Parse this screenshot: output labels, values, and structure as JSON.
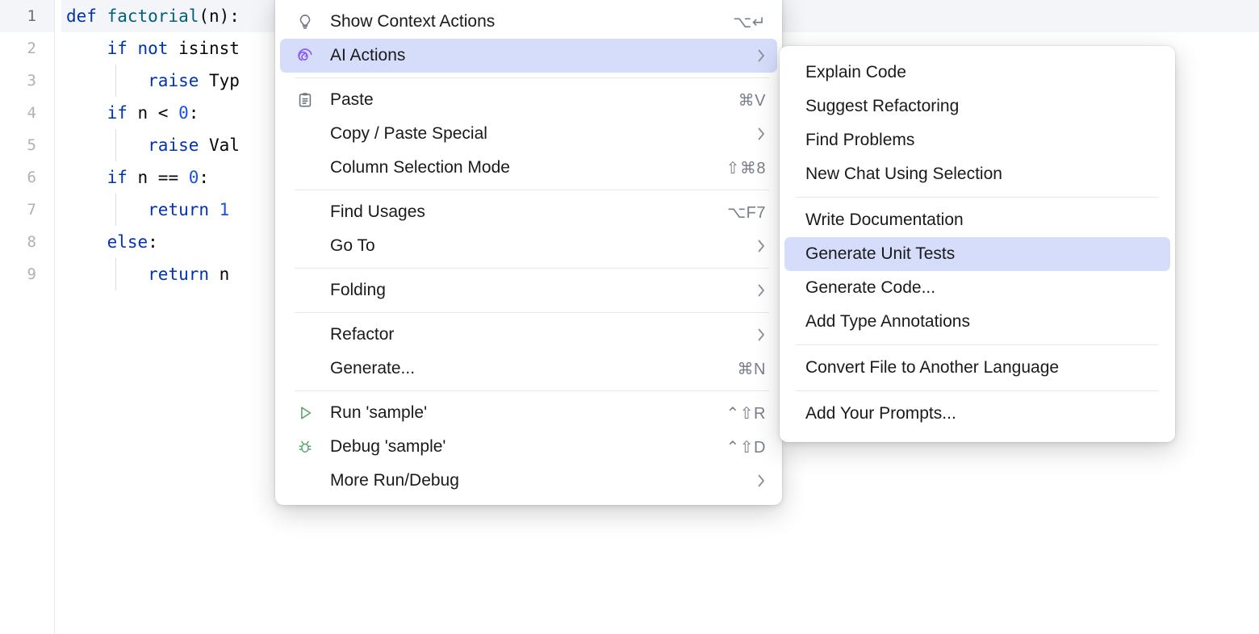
{
  "editor": {
    "language": "python",
    "lines": [
      {
        "num": "1",
        "current": true,
        "indent": 0,
        "tokens": [
          {
            "t": "def ",
            "c": "kw"
          },
          {
            "t": "factorial",
            "c": "fn"
          },
          {
            "t": "(n):",
            "c": "pl"
          }
        ]
      },
      {
        "num": "2",
        "current": false,
        "indent": 0,
        "tokens": [
          {
            "t": "    ",
            "c": "pl"
          },
          {
            "t": "if not ",
            "c": "kw"
          },
          {
            "t": "isinst",
            "c": "pl"
          }
        ]
      },
      {
        "num": "3",
        "current": false,
        "indent": 1,
        "tokens": [
          {
            "t": "        ",
            "c": "pl"
          },
          {
            "t": "raise ",
            "c": "kw"
          },
          {
            "t": "Typ",
            "c": "pl"
          }
        ]
      },
      {
        "num": "4",
        "current": false,
        "indent": 0,
        "tokens": [
          {
            "t": "    ",
            "c": "pl"
          },
          {
            "t": "if ",
            "c": "kw"
          },
          {
            "t": "n < ",
            "c": "pl"
          },
          {
            "t": "0",
            "c": "num"
          },
          {
            "t": ":",
            "c": "pl"
          }
        ]
      },
      {
        "num": "5",
        "current": false,
        "indent": 1,
        "tokens": [
          {
            "t": "        ",
            "c": "pl"
          },
          {
            "t": "raise ",
            "c": "kw"
          },
          {
            "t": "Val",
            "c": "pl"
          }
        ]
      },
      {
        "num": "6",
        "current": false,
        "indent": 0,
        "tokens": [
          {
            "t": "    ",
            "c": "pl"
          },
          {
            "t": "if ",
            "c": "kw"
          },
          {
            "t": "n == ",
            "c": "pl"
          },
          {
            "t": "0",
            "c": "num"
          },
          {
            "t": ":",
            "c": "pl"
          }
        ]
      },
      {
        "num": "7",
        "current": false,
        "indent": 1,
        "tokens": [
          {
            "t": "        ",
            "c": "pl"
          },
          {
            "t": "return ",
            "c": "kw"
          },
          {
            "t": "1",
            "c": "num"
          }
        ]
      },
      {
        "num": "8",
        "current": false,
        "indent": 0,
        "tokens": [
          {
            "t": "    ",
            "c": "pl"
          },
          {
            "t": "else",
            "c": "kw"
          },
          {
            "t": ":",
            "c": "pl"
          }
        ]
      },
      {
        "num": "9",
        "current": false,
        "indent": 1,
        "tokens": [
          {
            "t": "        ",
            "c": "pl"
          },
          {
            "t": "return ",
            "c": "kw"
          },
          {
            "t": "n ",
            "c": "pl"
          }
        ]
      }
    ]
  },
  "context_menu": {
    "items": [
      {
        "kind": "item",
        "icon": "lightbulb-icon",
        "label": "Show Context Actions",
        "shortcut": "⌥↵",
        "arrow": false,
        "selected": false
      },
      {
        "kind": "item",
        "icon": "ai-spiral-icon",
        "label": "AI Actions",
        "shortcut": "",
        "arrow": true,
        "selected": true
      },
      {
        "kind": "separator"
      },
      {
        "kind": "item",
        "icon": "clipboard-icon",
        "label": "Paste",
        "shortcut": "⌘V",
        "arrow": false,
        "selected": false
      },
      {
        "kind": "item",
        "icon": "none",
        "label": "Copy / Paste Special",
        "shortcut": "",
        "arrow": true,
        "selected": false
      },
      {
        "kind": "item",
        "icon": "none",
        "label": "Column Selection Mode",
        "shortcut": "⇧⌘8",
        "arrow": false,
        "selected": false
      },
      {
        "kind": "separator"
      },
      {
        "kind": "item",
        "icon": "none",
        "label": "Find Usages",
        "shortcut": "⌥F7",
        "arrow": false,
        "selected": false
      },
      {
        "kind": "item",
        "icon": "none",
        "label": "Go To",
        "shortcut": "",
        "arrow": true,
        "selected": false
      },
      {
        "kind": "separator"
      },
      {
        "kind": "item",
        "icon": "none",
        "label": "Folding",
        "shortcut": "",
        "arrow": true,
        "selected": false
      },
      {
        "kind": "separator"
      },
      {
        "kind": "item",
        "icon": "none",
        "label": "Refactor",
        "shortcut": "",
        "arrow": true,
        "selected": false
      },
      {
        "kind": "item",
        "icon": "none",
        "label": "Generate...",
        "shortcut": "⌘N",
        "arrow": false,
        "selected": false
      },
      {
        "kind": "separator"
      },
      {
        "kind": "item",
        "icon": "run-icon",
        "label": "Run 'sample'",
        "shortcut": "⌃⇧R",
        "arrow": false,
        "selected": false
      },
      {
        "kind": "item",
        "icon": "debug-icon",
        "label": "Debug 'sample'",
        "shortcut": "⌃⇧D",
        "arrow": false,
        "selected": false
      },
      {
        "kind": "item",
        "icon": "none",
        "label": "More Run/Debug",
        "shortcut": "",
        "arrow": true,
        "selected": false
      }
    ]
  },
  "ai_submenu": {
    "items": [
      {
        "kind": "item",
        "label": "Explain Code",
        "selected": false
      },
      {
        "kind": "item",
        "label": "Suggest Refactoring",
        "selected": false
      },
      {
        "kind": "item",
        "label": "Find Problems",
        "selected": false
      },
      {
        "kind": "item",
        "label": "New Chat Using Selection",
        "selected": false
      },
      {
        "kind": "separator"
      },
      {
        "kind": "item",
        "label": "Write Documentation",
        "selected": false
      },
      {
        "kind": "item",
        "label": "Generate Unit Tests",
        "selected": true
      },
      {
        "kind": "item",
        "label": "Generate Code...",
        "selected": false
      },
      {
        "kind": "item",
        "label": "Add Type Annotations",
        "selected": false
      },
      {
        "kind": "separator"
      },
      {
        "kind": "item",
        "label": "Convert File to Another Language",
        "selected": false
      },
      {
        "kind": "separator"
      },
      {
        "kind": "item",
        "label": "Add Your Prompts...",
        "selected": false
      }
    ]
  },
  "colors": {
    "selection": "#d6ddfb",
    "ai_accent": "#8b5cf6",
    "run_green": "#59a869",
    "icon_gray": "#6b7280",
    "current_line": "#f3f5f9"
  }
}
